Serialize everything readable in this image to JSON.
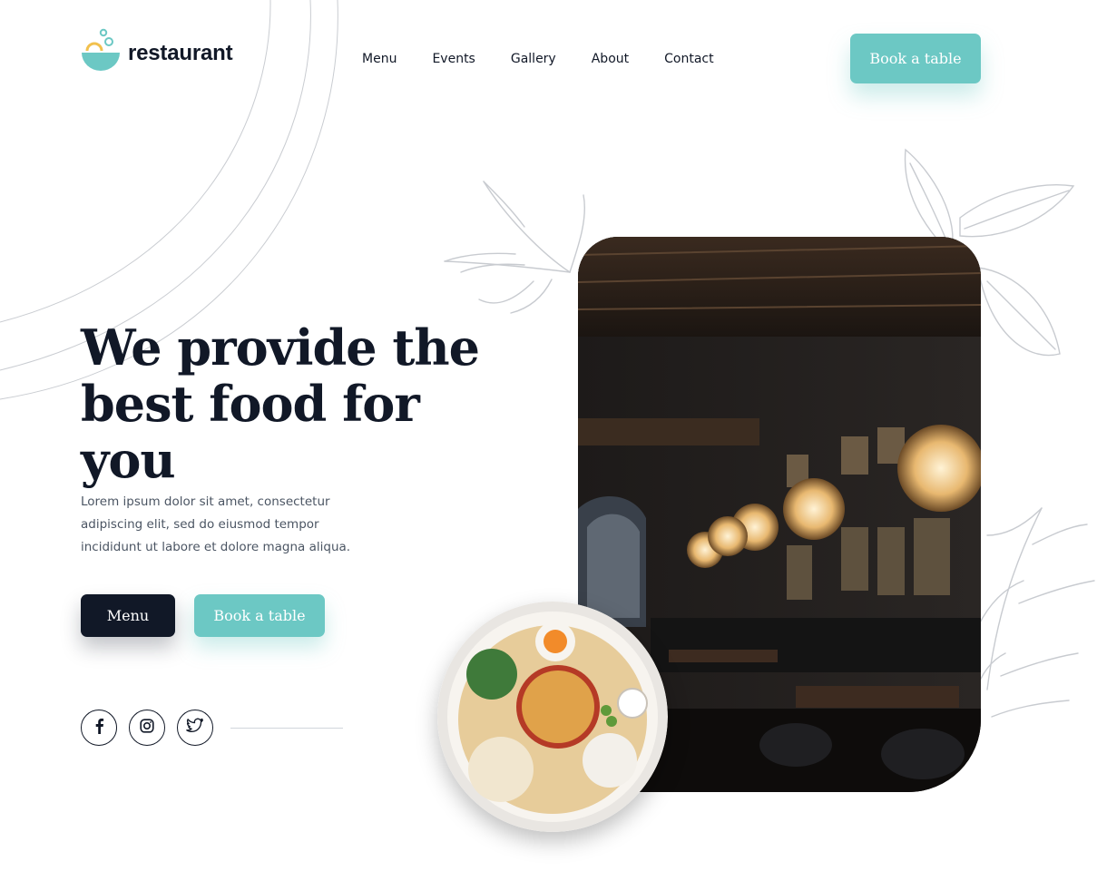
{
  "brand": {
    "name": "restaurant",
    "logo_icon": "bowl-bubbles-icon",
    "accent": "#6cc8c4",
    "dark": "#111827"
  },
  "nav": {
    "items": [
      {
        "label": "Menu"
      },
      {
        "label": "Events"
      },
      {
        "label": "Gallery"
      },
      {
        "label": "About"
      },
      {
        "label": "Contact"
      }
    ],
    "cta_label": "Book a table"
  },
  "hero": {
    "title_line1": "We provide the",
    "title_line2": "best food for you",
    "description": "Lorem ipsum dolor sit amet, consectetur adipiscing elit, sed do eiusmod tempor incididunt ut labore et dolore magna aliqua.",
    "menu_button": "Menu",
    "book_button": "Book a table"
  },
  "socials": [
    {
      "icon": "facebook-icon"
    },
    {
      "icon": "instagram-icon"
    },
    {
      "icon": "twitter-icon"
    }
  ],
  "media": {
    "interior_photo": "restaurant-interior-photo",
    "dish_photo": "noodle-dish-photo"
  }
}
